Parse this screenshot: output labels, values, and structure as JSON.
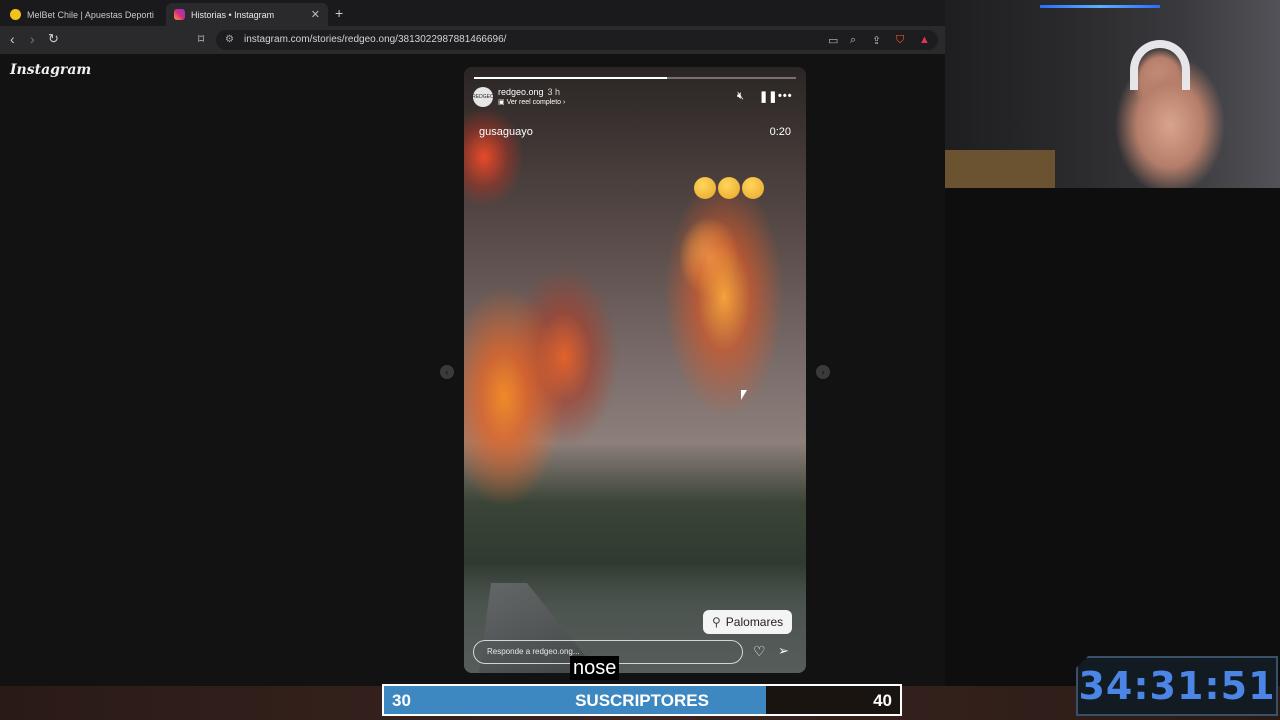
{
  "browser": {
    "tabs": [
      {
        "label": "MelBet Chile | Apuestas Deportivas C",
        "active": false
      },
      {
        "label": "Historias • Instagram",
        "active": true
      }
    ],
    "url": "instagram.com/stories/redgeo.ong/3813022987881466696/"
  },
  "instagram": {
    "logo": "Instagram",
    "story": {
      "avatar_text": "REDGEO",
      "username": "redgeo.ong",
      "time_ago": "3 h",
      "reel_link": "Ver reel completo",
      "tagged_user": "gusaguayo",
      "duration": "0:20",
      "progress": 0.6,
      "emoji_count": 3,
      "location_label": "Palomares",
      "reply_placeholder": "Responde a redgeo.ong..."
    }
  },
  "stream": {
    "subtitle": "nose",
    "goal": {
      "min": "30",
      "label": "SUSCRIPTORES",
      "max": "40",
      "fill_fraction": 0.74
    },
    "timer": "34:31:51"
  },
  "colors": {
    "accent": "#4b86e6",
    "goal_fill": "#3d88c0"
  },
  "icons": [
    "back-icon",
    "forward-icon",
    "reload-icon",
    "bookmark-icon",
    "mute-icon",
    "pause-icon",
    "more-icon",
    "location-pin-icon",
    "heart-icon",
    "send-icon"
  ]
}
